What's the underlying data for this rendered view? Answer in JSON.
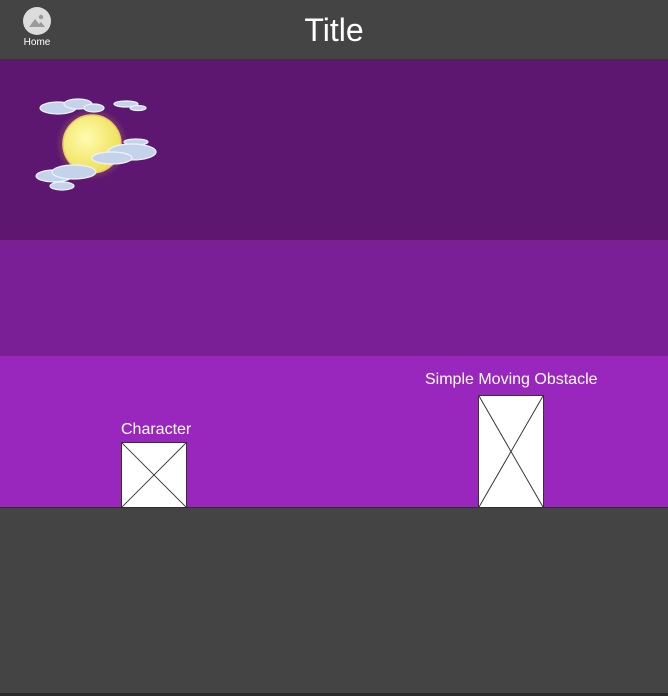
{
  "header": {
    "home_label": "Home",
    "title": "Title"
  },
  "scene": {
    "moon_icon": "moon-with-clouds",
    "character_label": "Character",
    "obstacle_label": "Simple Moving  Obstacle"
  },
  "colors": {
    "background": "#444444",
    "sky": "#5e1770",
    "midground": "#7b1f96",
    "ground": "#9a27bd"
  }
}
